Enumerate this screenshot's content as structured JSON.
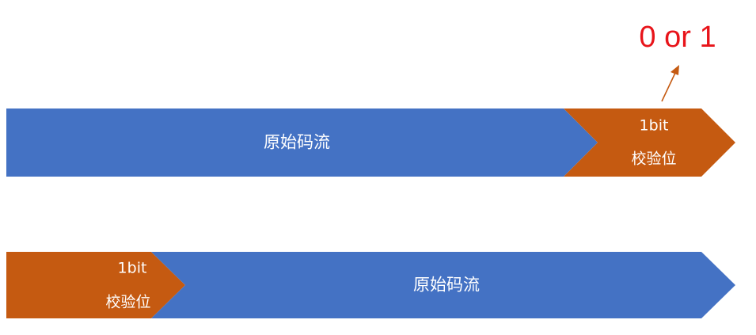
{
  "colors": {
    "raw_stream": "#4472c4",
    "check_bit": "#c55a11",
    "annotation": "#e8141a",
    "arrow": "#c55a11",
    "text": "#ffffff"
  },
  "row1": {
    "stream_label": "原始码流",
    "bit_size": "1bit",
    "bit_label": "校验位"
  },
  "row2": {
    "bit_size": "1bit",
    "bit_label": "校验位",
    "stream_label": "原始码流"
  },
  "annotation": {
    "text": "0 or 1"
  }
}
